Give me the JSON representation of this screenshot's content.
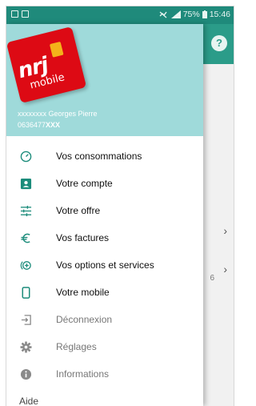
{
  "status_bar": {
    "battery": "75%",
    "time": "15:46"
  },
  "header": {
    "logo_brand": "nrj",
    "logo_sub": "mobile",
    "user_name": "xxxxxxxx Georges Pierre",
    "phone_prefix": "0636477",
    "phone_mask": "XXX"
  },
  "menu": {
    "items": [
      {
        "label": "Vos consommations",
        "icon": "gauge-icon"
      },
      {
        "label": "Votre compte",
        "icon": "account-card-icon"
      },
      {
        "label": "Votre offre",
        "icon": "sliders-icon"
      },
      {
        "label": "Vos factures",
        "icon": "euro-icon"
      },
      {
        "label": "Vos options et services",
        "icon": "add-circle-icon"
      },
      {
        "label": "Votre mobile",
        "icon": "smartphone-icon"
      },
      {
        "label": "Déconnexion",
        "icon": "logout-icon"
      },
      {
        "label": "Réglages",
        "icon": "gear-icon"
      },
      {
        "label": "Informations",
        "icon": "info-icon"
      }
    ],
    "aide": "Aide"
  },
  "background": {
    "help_symbol": "?",
    "chevron": "›",
    "partial_digit": "6"
  },
  "colors": {
    "teal_dark": "#1f8a7b",
    "teal": "#2b9c89",
    "header_bg": "#9fdada",
    "logo_red": "#dd0a14",
    "logo_yellow": "#f4b31a",
    "icon_teal": "#1c8c7b"
  }
}
